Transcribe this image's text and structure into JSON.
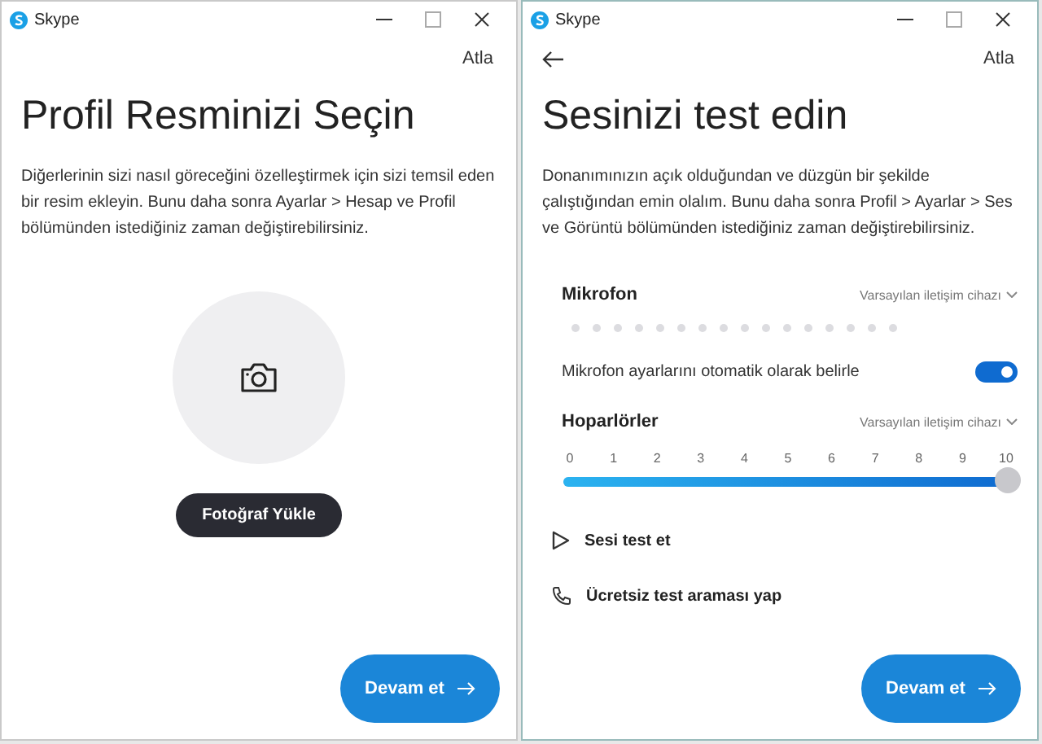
{
  "windows": [
    {
      "app_title": "Skype",
      "back": false,
      "skip": "Atla",
      "title": "Profil Resminizi Seçin",
      "description": "Diğerlerinin sizi nasıl göreceğini özelleştirmek için sizi temsil eden bir resim ekleyin. Bunu daha sonra Ayarlar > Hesap ve Profil bölümünden istediğiniz zaman değiştirebilirsiniz.",
      "kind": "profile",
      "upload_button": "Fotoğraf Yükle",
      "continue_button": "Devam et"
    },
    {
      "app_title": "Skype",
      "back": true,
      "skip": "Atla",
      "title": "Sesinizi test edin",
      "description": "Donanımınızın açık olduğundan ve düzgün bir şekilde çalıştığından emin olalım. Bunu daha sonra Profil > Ayarlar > Ses ve Görüntü bölümünden istediğiniz zaman değiştirebilirsiniz.",
      "kind": "audio",
      "microphone": {
        "label": "Mikrofon",
        "device": "Varsayılan iletişim cihazı"
      },
      "auto_setting": {
        "label": "Mikrofon ayarlarını otomatik olarak belirle",
        "on": true
      },
      "speakers": {
        "label": "Hoparlörler",
        "device": "Varsayılan iletişim cihazı",
        "ticks": [
          "0",
          "1",
          "2",
          "3",
          "4",
          "5",
          "6",
          "7",
          "8",
          "9",
          "10"
        ],
        "level": 1
      },
      "actions": [
        {
          "kind": "play",
          "label": "Sesi test et"
        },
        {
          "kind": "call",
          "label": "Ücretsiz test araması yap"
        }
      ],
      "continue_button": "Devam et"
    }
  ]
}
